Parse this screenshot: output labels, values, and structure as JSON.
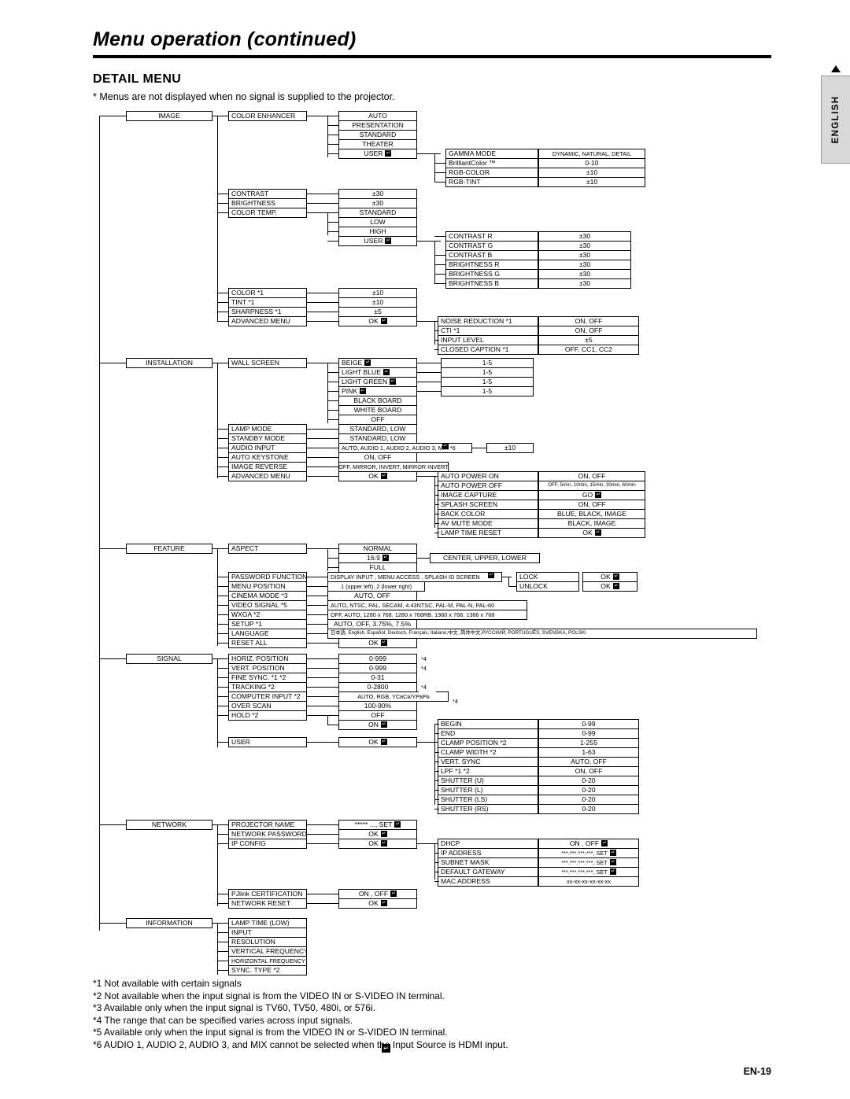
{
  "header": {
    "title": "Menu operation (continued)",
    "section": "DETAIL MENU",
    "note": "* Menus are not displayed when no signal is supplied to the projector.",
    "side_tab": "ENGLISH",
    "page_number": "EN-19"
  },
  "menu": {
    "roots": [
      "IMAGE",
      "INSTALLATION",
      "FEATURE",
      "SIGNAL",
      "NETWORK",
      "INFORMATION"
    ],
    "image": {
      "items": [
        "COLOR ENHANCER",
        "CONTRAST",
        "BRIGHTNESS",
        "COLOR TEMP.",
        "COLOR *1",
        "TINT *1",
        "SHARPNESS *1",
        "ADVANCED MENU"
      ],
      "color_enhancer_values": [
        "AUTO",
        "PRESENTATION",
        "STANDARD",
        "THEATER",
        "USER"
      ],
      "user_sub": [
        "GAMMA MODE",
        "BrilliantColor ™",
        "RGB-COLOR",
        "RGB-TINT"
      ],
      "user_sub_values": [
        "DYNAMIC, NATURAL, DETAIL",
        "0-10",
        "±10",
        "±10"
      ],
      "contrast_value": "±30",
      "brightness_value": "±30",
      "color_temp_values": [
        "STANDARD",
        "LOW",
        "HIGH",
        "USER"
      ],
      "color_temp_user_sub": [
        "CONTRAST R",
        "CONTRAST G",
        "CONTRAST B",
        "BRIGHTNESS R",
        "BRIGHTNESS G",
        "BRIGHTNESS B"
      ],
      "color_temp_user_values": [
        "±30",
        "±30",
        "±30",
        "±30",
        "±30",
        "±30"
      ],
      "color_value": "±10",
      "tint_value": "±10",
      "sharpness_value": "±5",
      "advanced_ok": "OK",
      "advanced_sub": [
        "NOISE REDUCTION *1",
        "CTI *1",
        "INPUT LEVEL",
        "CLOSED CAPTION *1"
      ],
      "advanced_values": [
        "ON, OFF",
        "ON, OFF",
        "±5",
        "OFF, CC1, CC2"
      ]
    },
    "installation": {
      "items": [
        "WALL SCREEN",
        "LAMP MODE",
        "STANDBY MODE",
        "AUDIO INPUT",
        "AUTO KEYSTONE",
        "IMAGE REVERSE",
        "ADVANCED MENU"
      ],
      "wall_screen_values": [
        "BEIGE",
        "LIGHT BLUE",
        "LIGHT GREEN",
        "PINK",
        "BLACK BOARD",
        "WHITE BOARD",
        "OFF"
      ],
      "wall_screen_levels": [
        "1-5",
        "1-5",
        "1-5",
        "1-5"
      ],
      "lamp_mode_value": "STANDARD, LOW",
      "standby_mode_value": "STANDARD, LOW",
      "audio_input_value": "AUTO, AUDIO 1, AUDIO 2, AUDIO 3, MIX      *6",
      "audio_input_level": "±10",
      "auto_keystone_value": "ON, OFF",
      "image_reverse_value": "OFF, MIRROR, INVERT, MIRROR INVERT",
      "advanced_ok": "OK",
      "advanced_sub": [
        "AUTO POWER ON",
        "AUTO POWER OFF",
        "IMAGE CAPTURE",
        "SPLASH SCREEN",
        "BACK COLOR",
        "AV MUTE MODE",
        "LAMP TIME RESET"
      ],
      "advanced_values": [
        "ON, OFF",
        "OFF, 5min, 10min, 15min, 30min, 60min",
        "GO",
        "ON, OFF",
        "BLUE, BLACK, IMAGE",
        "BLACK, IMAGE",
        "OK"
      ]
    },
    "feature": {
      "items": [
        "ASPECT",
        "PASSWORD FUNCTION",
        "MENU POSITION",
        "CINEMA MODE *3",
        "VIDEO SIGNAL *5",
        "WXGA *2",
        "SETUP *1",
        "LANGUAGE",
        "RESET ALL"
      ],
      "aspect_values": [
        "NORMAL",
        "16:9",
        "FULL"
      ],
      "aspect_169_sub": "CENTER, UPPER, LOWER",
      "password_value": "DISPLAY INPUT      , MENU ACCESS      , SPLASH ID SCREEN",
      "password_sub": [
        "LOCK",
        "UNLOCK"
      ],
      "password_sub_values": [
        "OK",
        "OK"
      ],
      "menu_position_value": "1 (upper left),  2 (lower right)",
      "cinema_mode_value": "AUTO, OFF",
      "video_signal_value": "AUTO, NTSC, PAL, SECAM, 4.43NTSC, PAL-M, PAL-N, PAL-60",
      "wxga_value": "OFF, AUTO, 1280 x 768, 1280 x 768RB, 1360 x 768, 1366 x 768",
      "setup_value": "AUTO, OFF, 3.75%, 7.5%",
      "language_value": "日本語, English, Español, Deutsch, Français, Italiano,中文 ,简体中文,РУССКИЙ, PORTUGUÊS, SVENSKA, POLSKI",
      "reset_all_value": "OK"
    },
    "signal": {
      "items": [
        "HORIZ. POSITION",
        "VERT. POSITION",
        "FINE SYNC. *1 *2",
        "TRACKING *2",
        "COMPUTER INPUT *2",
        "OVER SCAN",
        "HOLD *2",
        "USER"
      ],
      "values": [
        "0-999",
        "0-999",
        "0-31",
        "0-2800",
        "AUTO, RGB, YCʙCʀ/YPʙPʀ",
        "100-90%",
        "OFF",
        "OK"
      ],
      "marks": [
        "*4",
        "*4",
        "",
        "*4",
        "*4",
        "",
        "",
        ""
      ],
      "hold_on": "ON",
      "user_sub": [
        "BEGIN",
        "END",
        "CLAMP POSITION *2",
        "CLAMP WIDTH *2",
        "VERT. SYNC",
        "LPF *1 *2",
        "SHUTTER (U)",
        "SHUTTER (L)",
        "SHUTTER (LS)",
        "SHUTTER (RS)"
      ],
      "user_values": [
        "0-99",
        "0-99",
        "1-255",
        "1-63",
        "AUTO, OFF",
        "ON, OFF",
        "0-20",
        "0-20",
        "0-20",
        "0-20"
      ]
    },
    "network": {
      "items": [
        "PROJECTOR NAME",
        "NETWORK PASSWORD",
        "IP CONFIG",
        "PJlink CERTIFICATION",
        "NETWORK RESET"
      ],
      "values": [
        "***** ...,  SET",
        "OK",
        "OK",
        "ON      , OFF",
        "OK"
      ],
      "ipconfig_sub": [
        "DHCP",
        "IP ADDRESS",
        "SUBNET MASK",
        "DEFAULT GATEWAY",
        "MAC ADDRESS"
      ],
      "ipconfig_values": [
        "ON      , OFF",
        "***.***.***.***,  SET",
        "***.***.***.***,  SET",
        "***.***.***.***,  SET",
        "xx-xx-xx-xx-xx-xx"
      ]
    },
    "information": {
      "items": [
        "LAMP TIME (LOW)",
        "INPUT",
        "RESOLUTION",
        "VERTICAL FREQUENCY",
        "HORIZONTAL FREQUENCY",
        "SYNC. TYPE *2"
      ]
    }
  },
  "footnotes": [
    "*1 Not available with certain signals",
    "*2 Not available when the input signal is from the VIDEO IN or S-VIDEO IN terminal.",
    "*3 Available only when the input signal is TV60, TV50, 480i, or 576i.",
    "*4 The range that can be specified varies across input signals.",
    "*5 Available only when the input signal is from the VIDEO IN or S-VIDEO IN terminal.",
    "*6 AUDIO 1, AUDIO 2, AUDIO 3, and MIX       cannot be selected when the Input Source is HDMI input."
  ]
}
